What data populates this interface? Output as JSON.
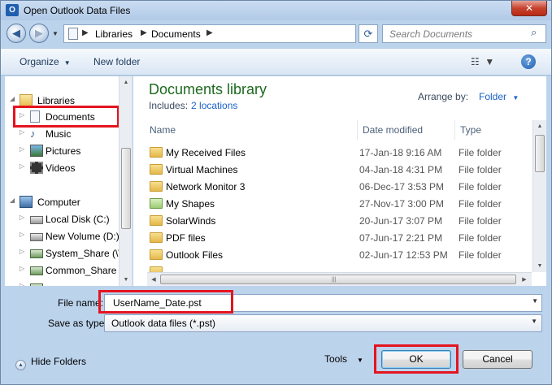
{
  "window": {
    "title": "Open Outlook Data Files",
    "close_glyph": "✕",
    "app_icon_letter": "O"
  },
  "address": {
    "crumbs": [
      "Libraries",
      "Documents"
    ],
    "search_placeholder": "Search Documents"
  },
  "toolbar": {
    "organize": "Organize",
    "new_folder": "New folder",
    "help": "?"
  },
  "nav": {
    "libraries": "Libraries",
    "documents": "Documents",
    "music": "Music",
    "pictures": "Pictures",
    "videos": "Videos",
    "computer": "Computer",
    "local_disk": "Local Disk (C:)",
    "new_volume": "New Volume (D:)",
    "system_share": "System_Share (\\\\",
    "common_share": "Common_Share"
  },
  "content": {
    "title": "Documents library",
    "includes_label": "Includes:",
    "includes_link": "2 locations",
    "arrange_label": "Arrange by:",
    "arrange_value": "Folder",
    "columns": {
      "name": "Name",
      "date": "Date modified",
      "type": "Type"
    },
    "files": [
      {
        "name": "My Received Files",
        "date": "17-Jan-18 9:16 AM",
        "type": "File folder"
      },
      {
        "name": "Virtual Machines",
        "date": "04-Jan-18 4:31 PM",
        "type": "File folder"
      },
      {
        "name": "Network Monitor 3",
        "date": "06-Dec-17 3:53 PM",
        "type": "File folder"
      },
      {
        "name": "My Shapes",
        "date": "27-Nov-17 3:00 PM",
        "type": "File folder"
      },
      {
        "name": "SolarWinds",
        "date": "20-Jun-17 3:07 PM",
        "type": "File folder"
      },
      {
        "name": "PDF files",
        "date": "07-Jun-17 2:21 PM",
        "type": "File folder"
      },
      {
        "name": "Outlook Files",
        "date": "02-Jun-17 12:53 PM",
        "type": "File folder"
      }
    ]
  },
  "footer": {
    "file_name_label": "File name:",
    "file_name_value": "UserName_Date.pst",
    "save_type_label": "Save as type:",
    "save_type_value": "Outlook data files (*.pst)",
    "hide_folders": "Hide Folders",
    "tools": "Tools",
    "ok": "OK",
    "cancel": "Cancel"
  },
  "colors": {
    "highlight": "#e4141f",
    "link": "#1a62c7",
    "library_title": "#1d6a1f"
  }
}
